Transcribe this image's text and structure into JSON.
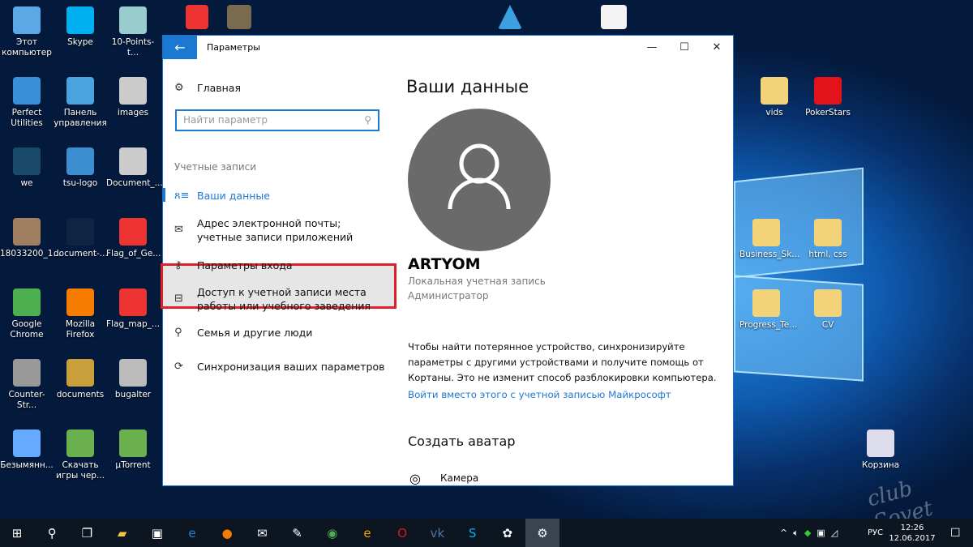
{
  "desktop": {
    "left_icons": [
      {
        "label": "Этот компьютер",
        "color": "#5aa9e6"
      },
      {
        "label": "Skype",
        "color": "#00aff0"
      },
      {
        "label": "10-Points-t...",
        "color": "#9cc"
      },
      {
        "label": "Perfect Utilities",
        "color": "#3a8fd8"
      },
      {
        "label": "Панель управления",
        "color": "#4aa3df"
      },
      {
        "label": "images",
        "color": "#ccc"
      },
      {
        "label": "we",
        "color": "#1a4a6a"
      },
      {
        "label": "tsu-logo",
        "color": "#3d8ed0"
      },
      {
        "label": "Document_...",
        "color": "#ccc"
      },
      {
        "label": "18033200_1...",
        "color": "#a08060"
      },
      {
        "label": "document-...",
        "color": "#0d2540"
      },
      {
        "label": "Flag_of_Ge...",
        "color": "#e33"
      },
      {
        "label": "Google Chrome",
        "color": "#4caf50"
      },
      {
        "label": "Mozilla Firefox",
        "color": "#f57c00"
      },
      {
        "label": "Flag_map_...",
        "color": "#e33"
      },
      {
        "label": "Counter-Str...",
        "color": "#999"
      },
      {
        "label": "documents",
        "color": "#c9a03c"
      },
      {
        "label": "bugalter",
        "color": "#bbb"
      },
      {
        "label": "Безымянн...",
        "color": "#6af"
      },
      {
        "label": "Скачать игры чер...",
        "color": "#6ab04c"
      },
      {
        "label": "µTorrent",
        "color": "#6ab04c"
      }
    ],
    "right_icons": [
      {
        "label": "vids",
        "color": "#f3d37a"
      },
      {
        "label": "PokerStars",
        "color": "#e3131b"
      },
      {
        "label": "Business_Sk...",
        "color": "#f3d37a"
      },
      {
        "label": "html, css",
        "color": "#f3d37a"
      },
      {
        "label": "Progress_Te...",
        "color": "#f3d37a"
      },
      {
        "label": "CV",
        "color": "#f3d37a"
      },
      {
        "label": "Корзина",
        "color": "#dde"
      }
    ],
    "watermark": "club Sovet"
  },
  "window": {
    "title": "Параметры",
    "back_icon": "arrow-left-icon",
    "left": {
      "home": "Главная",
      "search_placeholder": "Найти параметр",
      "section": "Учетные записи",
      "items": [
        {
          "label": "Ваши данные",
          "icon": "person-list-icon",
          "active": true
        },
        {
          "label": "Адрес электронной почты; учетные записи приложений",
          "icon": "mail-icon"
        },
        {
          "label": "Параметры входа",
          "icon": "key-icon",
          "highlighted": true
        },
        {
          "label": "Доступ к учетной записи места работы или учебного заведения",
          "icon": "briefcase-icon"
        },
        {
          "label": "Семья и другие люди",
          "icon": "person-add-icon"
        },
        {
          "label": "Синхронизация ваших параметров",
          "icon": "sync-icon"
        }
      ]
    },
    "right": {
      "heading": "Ваши данные",
      "user_name": "ARTYOM",
      "account_type": "Локальная учетная запись",
      "role": "Администратор",
      "info": "Чтобы найти потерянное устройство, синхронизируйте параметры с другими устройствами и получите помощь от Кортаны. Это не изменит способ разблокировки компьютера.",
      "link": "Войти вместо этого с учетной записью Майкрософт",
      "create_avatar": "Создать аватар",
      "camera": "Камера"
    },
    "accent": "#1c79d1",
    "highlight_color": "#e0202a"
  },
  "taskbar": {
    "apps": [
      "windows-start-icon",
      "search-icon",
      "task-view-icon",
      "file-explorer-icon",
      "store-icon",
      "edge-icon",
      "firefox-icon",
      "mail-icon",
      "app-icon",
      "chrome-icon",
      "browser-e-icon",
      "opera-icon",
      "vk-icon",
      "skype-icon",
      "paint-icon",
      "settings-icon"
    ],
    "lang": "РУС",
    "time": "12:26",
    "date": "12.06.2017"
  }
}
